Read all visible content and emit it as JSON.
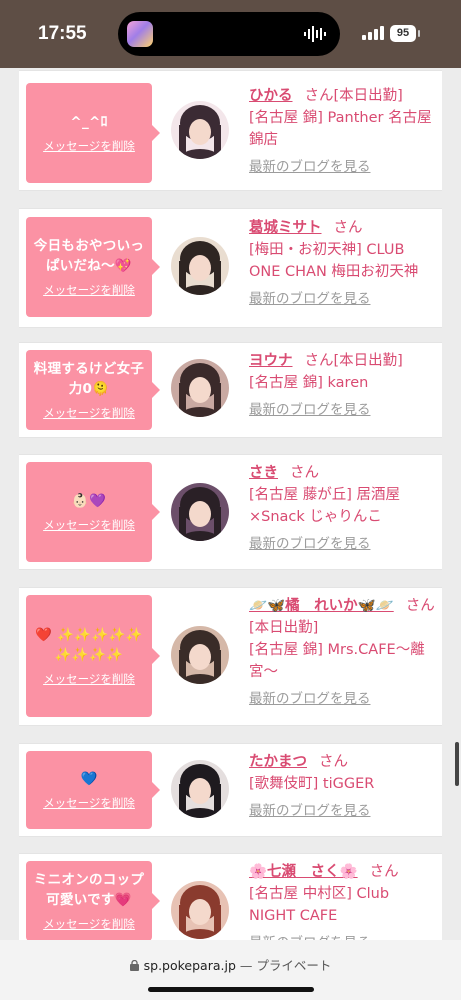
{
  "status_bar": {
    "time": "17:55",
    "battery": "95"
  },
  "browser": {
    "domain": "sp.pokepara.jp",
    "mode": "— プライベート"
  },
  "cards": [
    {
      "message": "^_^ﾛ",
      "delete_label": "メッセージを削除",
      "name": "ひかる",
      "suffix": "さん[本日出勤]",
      "shop": "[名古屋 錦] Panther 名古屋錦店",
      "blog": "最新のブログを見る",
      "avatar_colors": [
        "#f3e6ea",
        "#3b2b34"
      ]
    },
    {
      "message": "今日もおやついっぱいだね〜💖",
      "delete_label": "メッセージを削除",
      "name": "葛城ミサト",
      "suffix": "さん",
      "shop": "[梅田・お初天神] CLUB ONE CHAN 梅田お初天神",
      "blog": "最新のブログを見る",
      "avatar_colors": [
        "#e9ddd0",
        "#2e2522"
      ]
    },
    {
      "message": "料理するけど女子力0🫠",
      "delete_label": "メッセージを削除",
      "name": "ヨウナ",
      "suffix": "さん[本日出勤]",
      "shop": "[名古屋 錦] karen",
      "blog": "最新のブログを見る",
      "avatar_colors": [
        "#c9a9a2",
        "#3b2a2a"
      ]
    },
    {
      "message": "👶🏻💜",
      "delete_label": "メッセージを削除",
      "name": "さき",
      "suffix": "さん",
      "shop": "[名古屋 藤が丘] 居酒屋×Snack じゃりんこ",
      "blog": "最新のブログを見る",
      "avatar_colors": [
        "#6c4f6a",
        "#2a2026"
      ]
    },
    {
      "message": "❤️ ✨✨✨✨✨ ✨✨✨✨",
      "delete_label": "メッセージを削除",
      "name": "🪐🦋橘　れいか🦋🪐",
      "suffix": "さん[本日出勤]",
      "shop": "[名古屋 錦] Mrs.CAFE〜離宮〜",
      "blog": "最新のブログを見る",
      "avatar_colors": [
        "#d5b8a8",
        "#3a2c28"
      ]
    },
    {
      "message": "💙",
      "delete_label": "メッセージを削除",
      "name": "たかまつ",
      "suffix": "さん",
      "shop": "[歌舞伎町] tiGGER",
      "blog": "最新のブログを見る",
      "avatar_colors": [
        "#e4dede",
        "#1e1a1f"
      ]
    },
    {
      "message": "ミニオンのコップ可愛いです💗",
      "delete_label": "メッセージを削除",
      "name": "🌸七瀬　さく🌸",
      "suffix": "さん",
      "shop": "[名古屋 中村区] Club NIGHT CAFE",
      "blog": "最新のブログを見る",
      "avatar_colors": [
        "#e7c2b4",
        "#8a3b2e"
      ]
    }
  ]
}
